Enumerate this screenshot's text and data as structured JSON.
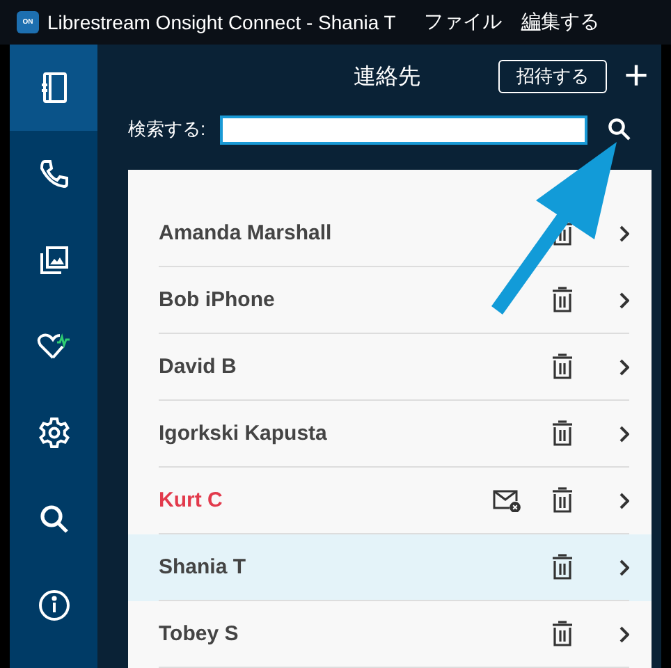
{
  "window": {
    "logo_text": "ON",
    "title": "Librestream Onsight Connect - Shania T"
  },
  "menu": [
    {
      "label": "ファイル",
      "underline_first": false
    },
    {
      "label": "編集する",
      "underline_first": true
    }
  ],
  "sidebar": {
    "items": [
      {
        "kind": "contacts",
        "selected": true
      },
      {
        "kind": "calls",
        "selected": false
      },
      {
        "kind": "gallery",
        "selected": false
      },
      {
        "kind": "health",
        "selected": false
      },
      {
        "kind": "settings",
        "selected": false
      },
      {
        "kind": "search",
        "selected": false
      },
      {
        "kind": "info",
        "selected": false
      }
    ]
  },
  "header": {
    "title": "連絡先",
    "invite_button": "招待する",
    "add_button": "+"
  },
  "search": {
    "label": "検索する:"
  },
  "contacts": [
    {
      "name": "Amanda Marshall",
      "selected": false,
      "invite_failed": false
    },
    {
      "name": "Bob iPhone",
      "selected": false,
      "invite_failed": false
    },
    {
      "name": "David B",
      "selected": false,
      "invite_failed": false
    },
    {
      "name": "Igorkski Kapusta",
      "selected": false,
      "invite_failed": false
    },
    {
      "name": "Kurt C",
      "selected": false,
      "invite_failed": true
    },
    {
      "name": "Shania T",
      "selected": true,
      "invite_failed": false
    },
    {
      "name": "Tobey S",
      "selected": false,
      "invite_failed": false
    }
  ],
  "annotation": {
    "kind": "arrow"
  }
}
